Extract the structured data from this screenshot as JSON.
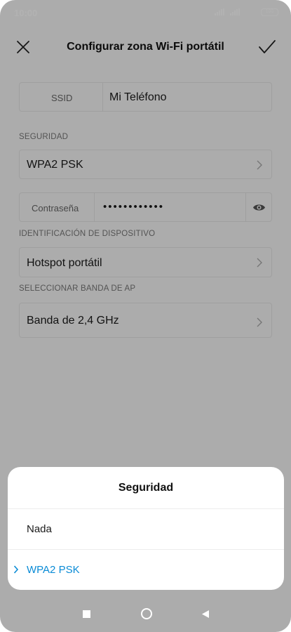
{
  "status_bar": {
    "time": "10:00",
    "battery": "100"
  },
  "header": {
    "title": "Configurar zona Wi-Fi portátil",
    "close_icon": "close-icon",
    "confirm_icon": "check-icon"
  },
  "ssid": {
    "label": "SSID",
    "value": "Mi Teléfono"
  },
  "security": {
    "section_label": "SEGURIDAD",
    "value": "WPA2 PSK"
  },
  "password": {
    "label": "Contraseña",
    "masked_value": "••••••••••••",
    "toggle_icon": "eye-icon"
  },
  "device_id": {
    "section_label": "IDENTIFICACIÓN DE DISPOSITIVO",
    "value": "Hotspot portátil"
  },
  "ap_band": {
    "section_label": "SELECCIONAR BANDA DE AP",
    "value": "Banda de 2,4 GHz"
  },
  "sheet": {
    "title": "Seguridad",
    "options": [
      {
        "label": "Nada",
        "selected": false
      },
      {
        "label": "WPA2 PSK",
        "selected": true
      }
    ]
  },
  "colors": {
    "accent": "#0a8bd6",
    "overlay": "rgba(0,0,0,0.3)"
  },
  "navbar": {
    "recents_icon": "square-icon",
    "home_icon": "circle-icon",
    "back_icon": "triangle-back-icon"
  }
}
